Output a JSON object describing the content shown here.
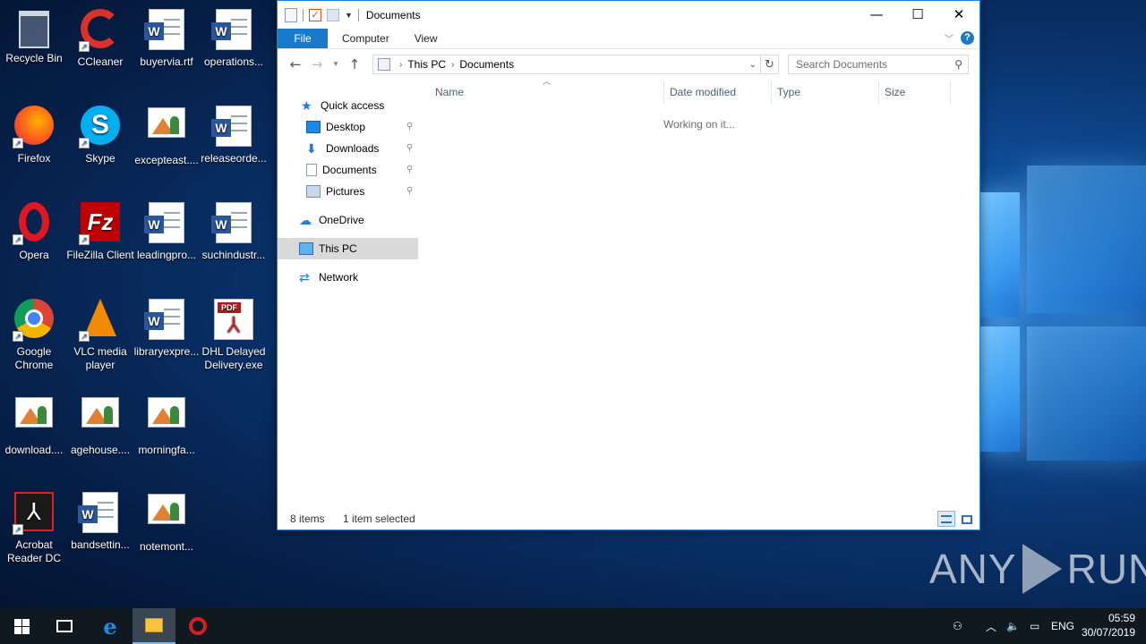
{
  "desktop": {
    "icons": [
      {
        "label": "Recycle Bin",
        "kind": "recycle-bin"
      },
      {
        "label": "CCleaner",
        "kind": "ccleaner"
      },
      {
        "label": "buyervia.rtf",
        "kind": "word-doc"
      },
      {
        "label": "operations...",
        "kind": "word-doc"
      },
      {
        "label": "Firefox",
        "kind": "firefox"
      },
      {
        "label": "Skype",
        "kind": "skype"
      },
      {
        "label": "excepteast....",
        "kind": "image"
      },
      {
        "label": "releaseorde...",
        "kind": "word-doc"
      },
      {
        "label": "Opera",
        "kind": "opera"
      },
      {
        "label": "FileZilla Client",
        "kind": "filezilla"
      },
      {
        "label": "leadingpro...",
        "kind": "word-doc"
      },
      {
        "label": "suchindustr...",
        "kind": "word-doc"
      },
      {
        "label": "Google Chrome",
        "kind": "chrome"
      },
      {
        "label": "VLC media player",
        "kind": "vlc"
      },
      {
        "label": "libraryexpre...",
        "kind": "word-doc"
      },
      {
        "label": "DHL Delayed Delivery.exe",
        "kind": "pdf"
      },
      {
        "label": "download....",
        "kind": "image"
      },
      {
        "label": "agehouse....",
        "kind": "image"
      },
      {
        "label": "morningfa...",
        "kind": "image"
      },
      {
        "label": "Acrobat Reader DC",
        "kind": "acrobat"
      },
      {
        "label": "bandsettin...",
        "kind": "word-doc"
      },
      {
        "label": "notemont...",
        "kind": "image"
      }
    ]
  },
  "window": {
    "title": "Documents",
    "controls": {
      "minimize": "—",
      "maximize": "☐",
      "close": "✕"
    },
    "ribbon_tabs": [
      "File",
      "Computer",
      "View"
    ],
    "help_label": "?",
    "address": {
      "segments": [
        "This PC",
        "Documents"
      ]
    },
    "search": {
      "placeholder": "Search Documents"
    },
    "nav": {
      "quick_access": "Quick access",
      "desktop": "Desktop",
      "downloads": "Downloads",
      "documents": "Documents",
      "pictures": "Pictures",
      "onedrive": "OneDrive",
      "this_pc": "This PC",
      "network": "Network"
    },
    "columns": [
      "Name",
      "Date modified",
      "Type",
      "Size"
    ],
    "status_message": "Working on it...",
    "statusbar": {
      "items": "8 items",
      "selected": "1 item selected"
    }
  },
  "taskbar": {
    "language": "ENG",
    "time": "05:59",
    "date": "30/07/2019"
  },
  "watermark": {
    "left": "ANY",
    "right": "RUN"
  },
  "colors": {
    "accent": "#1979ca",
    "selected_nav": "#d9d9d9",
    "taskbar": "#101820"
  }
}
